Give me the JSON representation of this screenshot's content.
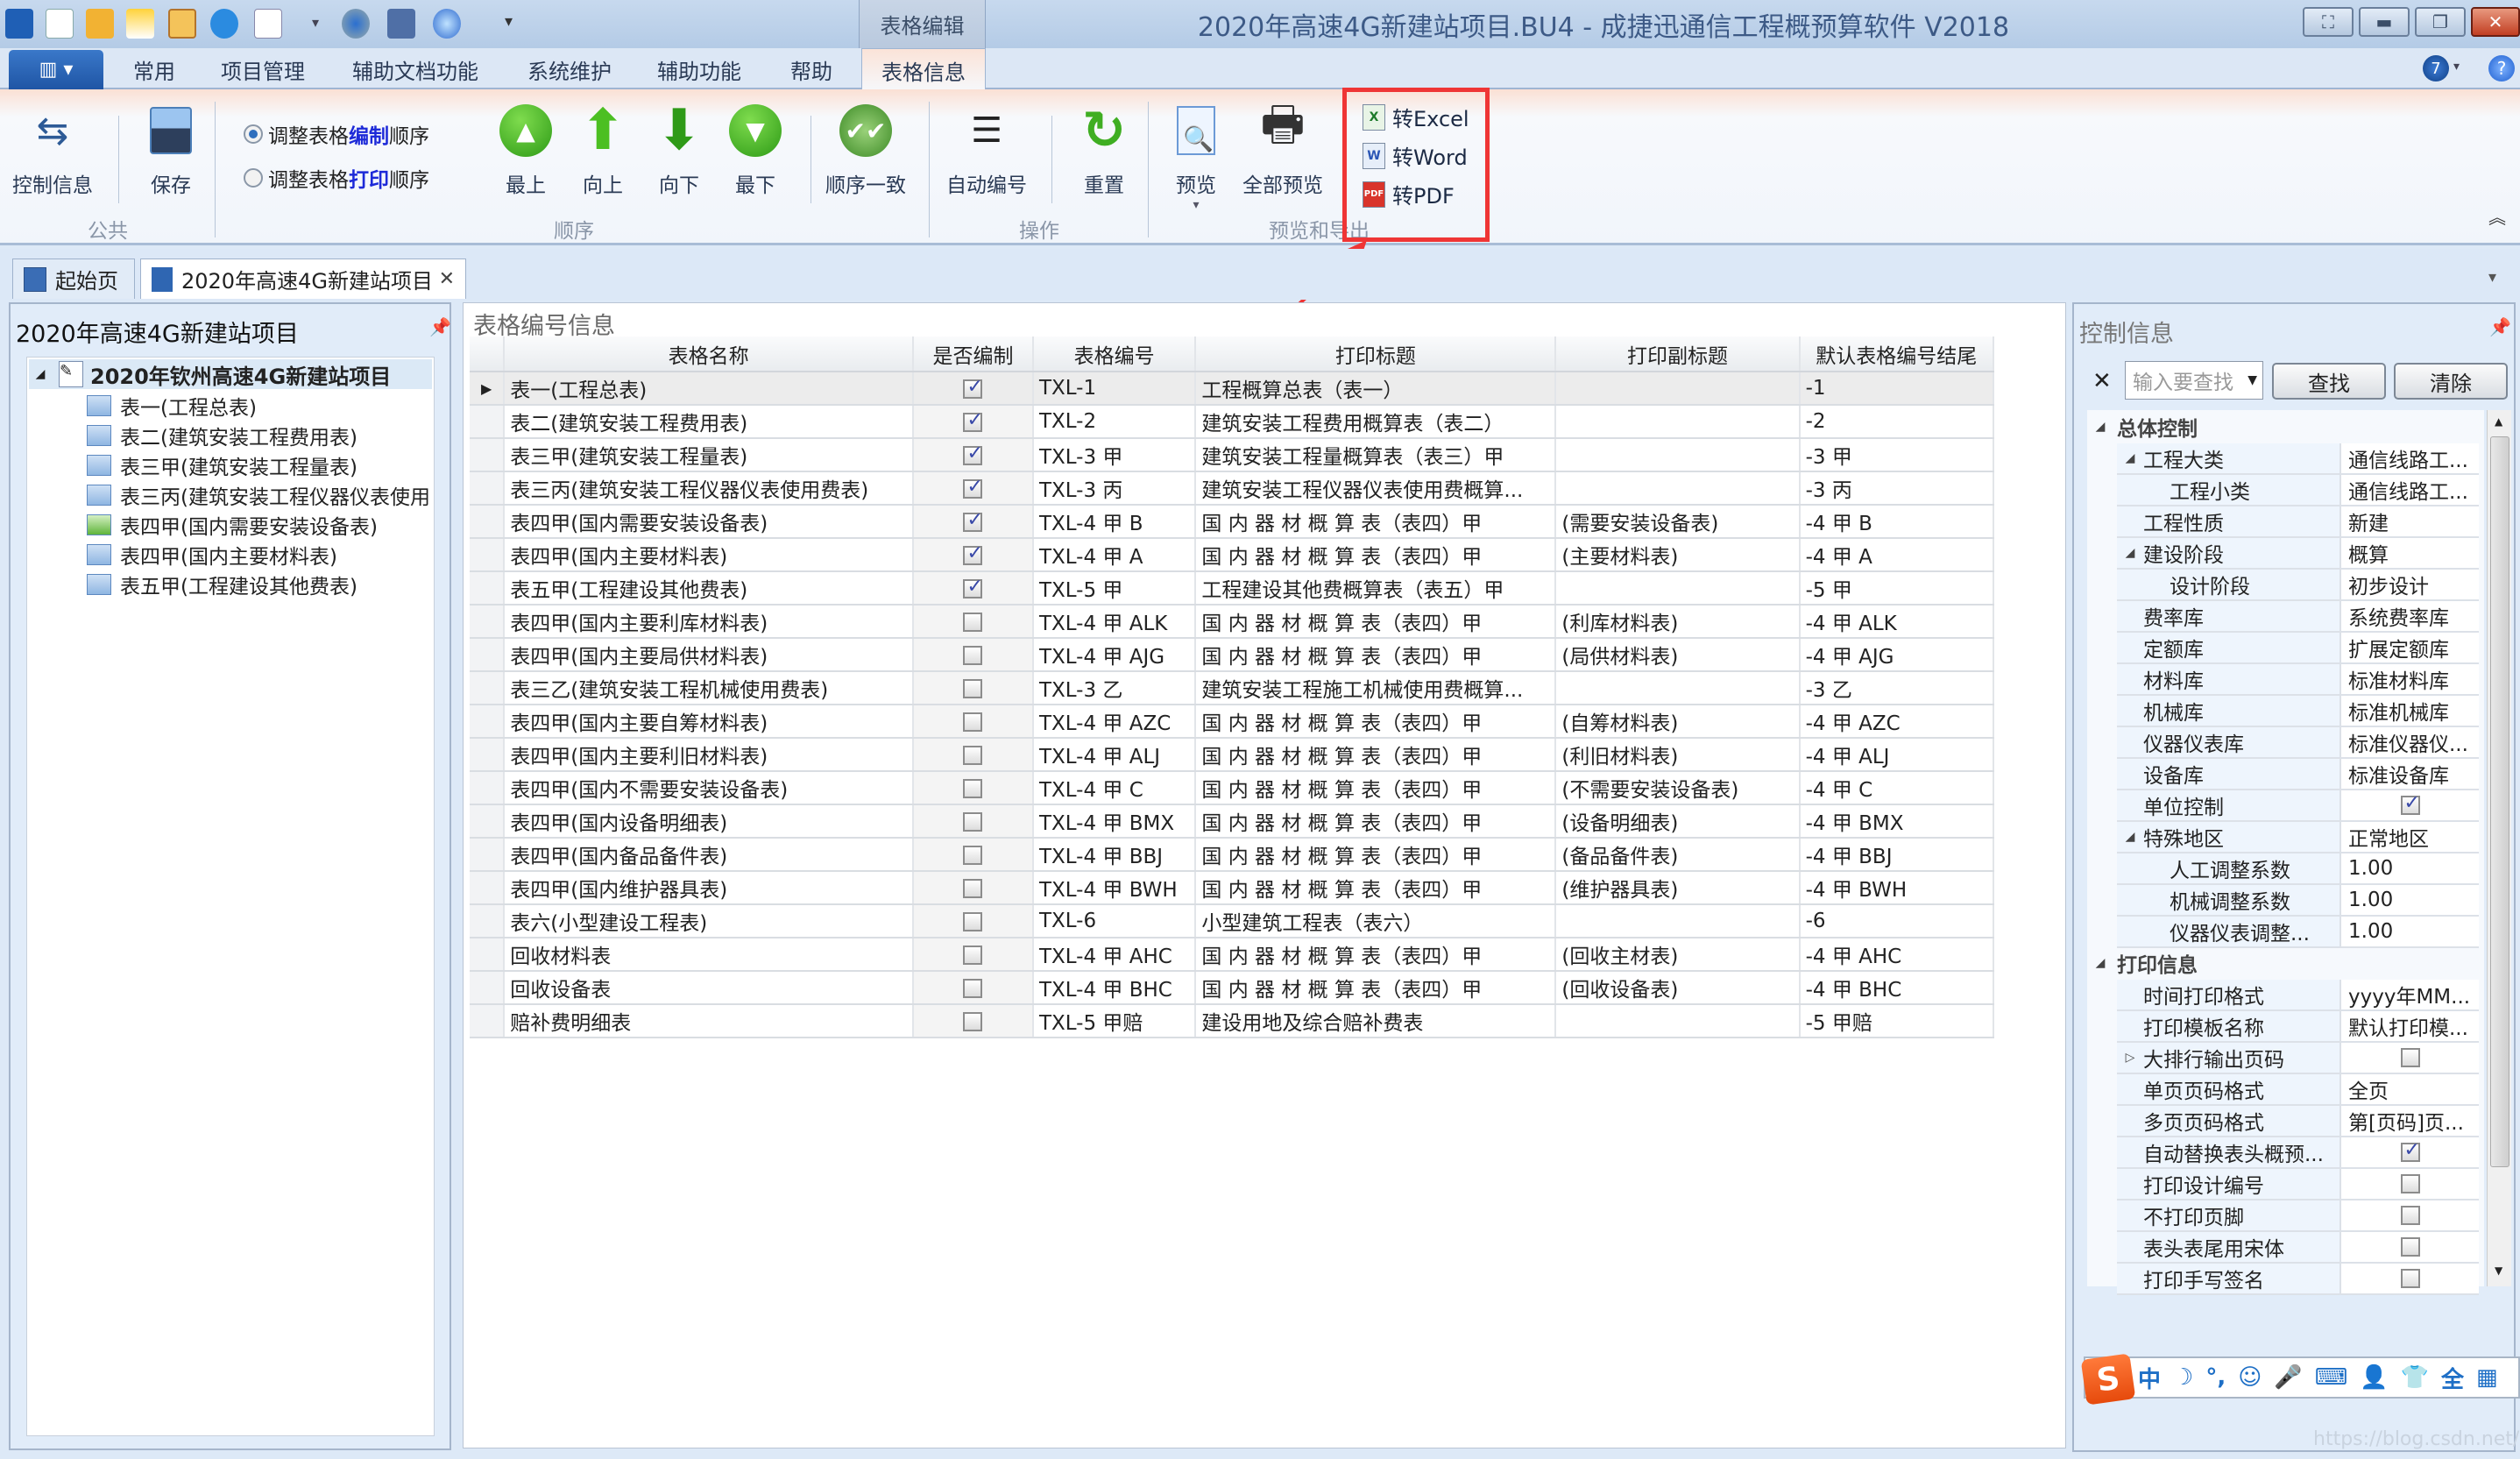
{
  "window": {
    "title": "2020年高速4G新建站项目.BU4 - 成捷迅通信工程概预算软件 V2018",
    "context_group": "表格编辑",
    "controls": [
      "capture-icon",
      "minimize-icon",
      "restore-icon",
      "close-icon"
    ]
  },
  "quick_access": [
    "app-logo-icon",
    "new-file-icon",
    "open-folder-icon",
    "new-project-icon",
    "layout-icon",
    "info-icon",
    "search-doc-icon",
    "settings-icon",
    "calculator-icon",
    "zoom-icon",
    "customize-icon"
  ],
  "menu": {
    "tabs": [
      "常用",
      "项目管理",
      "辅助文档功能",
      "系统维护",
      "辅助功能",
      "帮助",
      "表格信息"
    ],
    "active": "表格信息",
    "version_badge": "7"
  },
  "ribbon": {
    "groups": {
      "common": {
        "label": "公共",
        "buttons": [
          {
            "label": "控制信息",
            "icon": "control-info-icon"
          },
          {
            "label": "保存",
            "icon": "save-icon"
          }
        ]
      },
      "order": {
        "label": "顺序",
        "radios": [
          {
            "prefix": "调整表格",
            "keyword": "编制",
            "suffix": "顺序",
            "checked": true
          },
          {
            "prefix": "调整表格",
            "keyword": "打印",
            "suffix": "顺序",
            "checked": false
          }
        ],
        "buttons": [
          {
            "label": "最上",
            "icon": "move-top-icon"
          },
          {
            "label": "向上",
            "icon": "move-up-icon"
          },
          {
            "label": "向下",
            "icon": "move-down-icon"
          },
          {
            "label": "最下",
            "icon": "move-bottom-icon"
          },
          {
            "label": "顺序一致",
            "icon": "sync-order-icon"
          }
        ]
      },
      "operation": {
        "label": "操作",
        "buttons": [
          {
            "label": "自动编号",
            "icon": "numbered-list-icon"
          },
          {
            "label": "重置",
            "icon": "reset-icon"
          }
        ]
      },
      "preview_export": {
        "label": "预览和导出",
        "buttons": [
          {
            "label": "预览",
            "icon": "preview-icon"
          },
          {
            "label": "全部预览",
            "icon": "print-preview-icon"
          }
        ],
        "exports": [
          {
            "label": "转Excel",
            "icon": "excel-icon"
          },
          {
            "label": "转Word",
            "icon": "word-icon"
          },
          {
            "label": "转PDF",
            "icon": "pdf-icon"
          }
        ]
      }
    }
  },
  "doc_tabs": [
    {
      "label": "起始页",
      "active": false
    },
    {
      "label": "2020年高速4G新建站项目",
      "active": true
    }
  ],
  "left_panel": {
    "title": "2020年高速4G新建站项目",
    "root": "2020年钦州高速4G新建站项目",
    "items": [
      "表一(工程总表)",
      "表二(建筑安装工程费用表)",
      "表三甲(建筑安装工程量表)",
      "表三丙(建筑安装工程仪器仪表使用费表)",
      "表四甲(国内需要安装设备表)",
      "表四甲(国内主要材料表)",
      "表五甲(工程建设其他费表)"
    ]
  },
  "center_panel": {
    "title": "表格编号信息",
    "columns": [
      "表格名称",
      "是否编制",
      "表格编号",
      "打印标题",
      "打印副标题",
      "默认表格编号结尾"
    ],
    "rows": [
      {
        "name": "表一(工程总表)",
        "compiled": true,
        "code": "TXL-1",
        "print_title": "工程概算总表（表一）",
        "subtitle": "",
        "suffix": "-1"
      },
      {
        "name": "表二(建筑安装工程费用表)",
        "compiled": true,
        "code": "TXL-2",
        "print_title": "建筑安装工程费用概算表（表二）",
        "subtitle": "",
        "suffix": "-2"
      },
      {
        "name": "表三甲(建筑安装工程量表)",
        "compiled": true,
        "code": "TXL-3 甲",
        "print_title": "建筑安装工程量概算表（表三）甲",
        "subtitle": "",
        "suffix": "-3 甲"
      },
      {
        "name": "表三丙(建筑安装工程仪器仪表使用费表)",
        "compiled": true,
        "code": "TXL-3 丙",
        "print_title": "建筑安装工程仪器仪表使用费概算...",
        "subtitle": "",
        "suffix": "-3 丙"
      },
      {
        "name": "表四甲(国内需要安装设备表)",
        "compiled": true,
        "code": "TXL-4 甲 B",
        "print_title": "国 内 器 材 概 算 表（表四）甲",
        "subtitle": "(需要安装设备表)",
        "suffix": "-4 甲 B"
      },
      {
        "name": "表四甲(国内主要材料表)",
        "compiled": true,
        "code": "TXL-4 甲 A",
        "print_title": "国 内 器 材 概 算 表（表四）甲",
        "subtitle": "(主要材料表)",
        "suffix": "-4 甲 A"
      },
      {
        "name": "表五甲(工程建设其他费表)",
        "compiled": true,
        "code": "TXL-5 甲",
        "print_title": "工程建设其他费概算表（表五）甲",
        "subtitle": "",
        "suffix": "-5 甲"
      },
      {
        "name": "表四甲(国内主要利库材料表)",
        "compiled": false,
        "code": "TXL-4 甲 ALK",
        "print_title": "国 内 器 材 概 算 表（表四）甲",
        "subtitle": "(利库材料表)",
        "suffix": "-4 甲 ALK"
      },
      {
        "name": "表四甲(国内主要局供材料表)",
        "compiled": false,
        "code": "TXL-4 甲 AJG",
        "print_title": "国 内 器 材 概 算 表（表四）甲",
        "subtitle": "(局供材料表)",
        "suffix": "-4 甲 AJG"
      },
      {
        "name": "表三乙(建筑安装工程机械使用费表)",
        "compiled": false,
        "code": "TXL-3 乙",
        "print_title": "建筑安装工程施工机械使用费概算...",
        "subtitle": "",
        "suffix": "-3 乙"
      },
      {
        "name": "表四甲(国内主要自筹材料表)",
        "compiled": false,
        "code": "TXL-4 甲 AZC",
        "print_title": "国 内 器 材 概 算 表（表四）甲",
        "subtitle": "(自筹材料表)",
        "suffix": "-4 甲 AZC"
      },
      {
        "name": "表四甲(国内主要利旧材料表)",
        "compiled": false,
        "code": "TXL-4 甲 ALJ",
        "print_title": "国 内 器 材 概 算 表（表四）甲",
        "subtitle": "(利旧材料表)",
        "suffix": "-4 甲 ALJ"
      },
      {
        "name": "表四甲(国内不需要安装设备表)",
        "compiled": false,
        "code": "TXL-4 甲 C",
        "print_title": "国 内 器 材 概 算 表（表四）甲",
        "subtitle": "(不需要安装设备表)",
        "suffix": "-4 甲 C"
      },
      {
        "name": "表四甲(国内设备明细表)",
        "compiled": false,
        "code": "TXL-4 甲 BMX",
        "print_title": "国 内 器 材 概 算 表（表四）甲",
        "subtitle": "(设备明细表)",
        "suffix": "-4 甲 BMX"
      },
      {
        "name": "表四甲(国内备品备件表)",
        "compiled": false,
        "code": "TXL-4 甲 BBJ",
        "print_title": "国 内 器 材 概 算 表（表四）甲",
        "subtitle": "(备品备件表)",
        "suffix": "-4 甲 BBJ"
      },
      {
        "name": "表四甲(国内维护器具表)",
        "compiled": false,
        "code": "TXL-4 甲 BWH",
        "print_title": "国 内 器 材 概 算 表（表四）甲",
        "subtitle": "(维护器具表)",
        "suffix": "-4 甲 BWH"
      },
      {
        "name": "表六(小型建设工程表)",
        "compiled": false,
        "code": "TXL-6",
        "print_title": "小型建筑工程表（表六）",
        "subtitle": "",
        "suffix": "-6"
      },
      {
        "name": "回收材料表",
        "compiled": false,
        "code": "TXL-4 甲 AHC",
        "print_title": "国 内 器 材 概 算 表（表四）甲",
        "subtitle": "(回收主材表)",
        "suffix": "-4 甲 AHC"
      },
      {
        "name": "回收设备表",
        "compiled": false,
        "code": "TXL-4 甲 BHC",
        "print_title": "国 内 器 材 概 算 表（表四）甲",
        "subtitle": "(回收设备表)",
        "suffix": "-4 甲 BHC"
      },
      {
        "name": "赔补费明细表",
        "compiled": false,
        "code": "TXL-5 甲赔",
        "print_title": "建设用地及综合赔补费表",
        "subtitle": "",
        "suffix": "-5 甲赔"
      }
    ]
  },
  "right_panel": {
    "title": "控制信息",
    "search_placeholder": "输入要查找",
    "find_label": "查找",
    "clear_label": "清除",
    "categories": [
      {
        "label": "总体控制",
        "props": [
          {
            "name": "工程大类",
            "value": "通信线路工...",
            "expander": "expanded",
            "indent": false
          },
          {
            "name": "工程小类",
            "value": "通信线路工...",
            "indent": true
          },
          {
            "name": "工程性质",
            "value": "新建",
            "indent": false
          },
          {
            "name": "建设阶段",
            "value": "概算",
            "expander": "expanded",
            "indent": false
          },
          {
            "name": "设计阶段",
            "value": "初步设计",
            "indent": true
          },
          {
            "name": "费率库",
            "value": "系统费率库",
            "indent": false
          },
          {
            "name": "定额库",
            "value": "扩展定额库",
            "indent": false
          },
          {
            "name": "材料库",
            "value": "标准材料库",
            "indent": false
          },
          {
            "name": "机械库",
            "value": "标准机械库",
            "indent": false
          },
          {
            "name": "仪器仪表库",
            "value": "标准仪器仪...",
            "indent": false
          },
          {
            "name": "设备库",
            "value": "标准设备库",
            "indent": false
          },
          {
            "name": "单位控制",
            "checkbox": true,
            "checked": true,
            "indent": false
          },
          {
            "name": "特殊地区",
            "value": "正常地区",
            "expander": "expanded",
            "indent": false
          },
          {
            "name": "人工调整系数",
            "value": "1.00",
            "indent": true
          },
          {
            "name": "机械调整系数",
            "value": "1.00",
            "indent": true
          },
          {
            "name": "仪器仪表调整...",
            "value": "1.00",
            "indent": true
          }
        ]
      },
      {
        "label": "打印信息",
        "props": [
          {
            "name": "时间打印格式",
            "value": "yyyy年MM...",
            "indent": false
          },
          {
            "name": "打印模板名称",
            "value": "默认打印模...",
            "indent": false
          },
          {
            "name": "大排行输出页码",
            "checkbox": true,
            "checked": false,
            "expander": "collapsed",
            "indent": false
          },
          {
            "name": "单页页码格式",
            "value": "全页",
            "indent": false
          },
          {
            "name": "多页页码格式",
            "value": "第[页码]页...",
            "indent": false
          },
          {
            "name": "自动替换表头概预...",
            "checkbox": true,
            "checked": true,
            "indent": false
          },
          {
            "name": "打印设计编号",
            "checkbox": true,
            "checked": false,
            "indent": false
          },
          {
            "name": "不打印页脚",
            "checkbox": true,
            "checked": false,
            "indent": false
          },
          {
            "name": "表头表尾用宋体",
            "checkbox": true,
            "checked": false,
            "indent": false
          },
          {
            "name": "打印手写签名",
            "checkbox": true,
            "checked": false,
            "indent": false
          }
        ]
      }
    ]
  },
  "ime_toolbar": {
    "logo": "S",
    "items": [
      "中",
      "☽",
      "°,",
      "☺",
      "🎤",
      "⌨",
      "👤",
      "👕",
      "全",
      "▦"
    ]
  },
  "watermark": "https://blog.csdn.net/kai_locust",
  "colors": {
    "highlight_box": "#ef3535",
    "accent_blue": "#1d2ad8",
    "app_menu": "#2a62b5"
  }
}
